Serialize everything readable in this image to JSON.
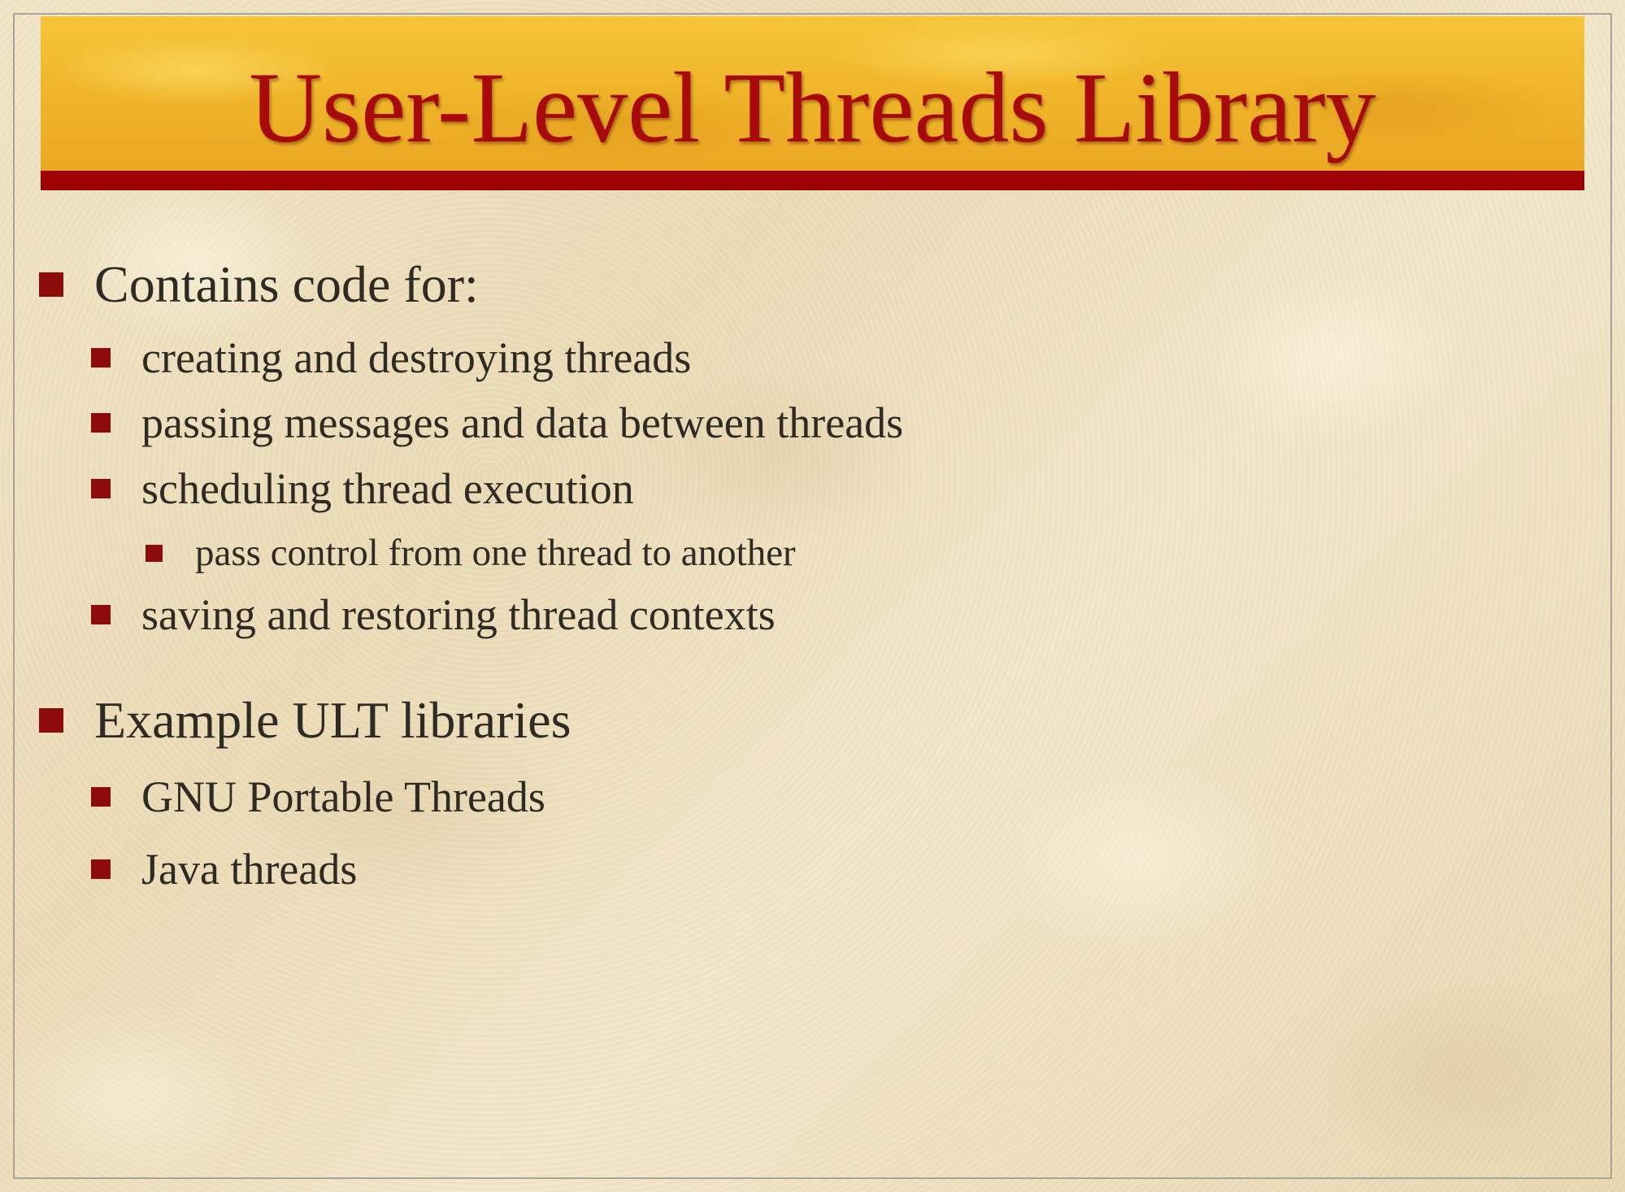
{
  "slide": {
    "title": "User-Level Threads Library",
    "sections": [
      {
        "heading": "Contains code for:",
        "items": [
          "creating and destroying threads",
          "passing messages and data between threads",
          "scheduling thread execution",
          "saving and restoring thread contexts"
        ],
        "sub_items": [
          "pass control from one thread to another"
        ]
      },
      {
        "heading": "Example ULT libraries",
        "items": [
          "GNU Portable Threads",
          "Java threads"
        ]
      }
    ]
  },
  "colors": {
    "title_text": "#a80a0a",
    "title_band": "#f0b62a",
    "title_rule": "#9e0000",
    "bullet": "#8d0b0b",
    "body_text": "#2e2a24",
    "background": "#efe3c3"
  }
}
